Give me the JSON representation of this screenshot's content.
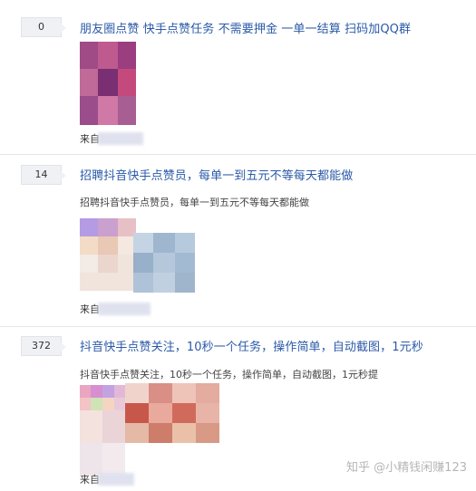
{
  "posts": [
    {
      "count": "0",
      "title": "朋友圈点赞 快手点赞任务 不需要押金 一单一结算 扫码加QQ群",
      "summary": "",
      "source_label": "来自"
    },
    {
      "count": "14",
      "title": "招聘抖音快手点赞员，每单一到五元不等每天都能做",
      "summary": "招聘抖音快手点赞员，每单一到五元不等每天都能做",
      "source_label": "来自"
    },
    {
      "count": "372",
      "title": "抖音快手点赞关注，10秒一个任务，操作简单，自动截图，1元秒",
      "summary": "抖音快手点赞关注，10秒一个任务，操作简单，自动截图，1元秒提",
      "source_label": "来自"
    }
  ],
  "watermark": "知乎 @小精钱闲赚123",
  "colors": {
    "title": "#2b5aa8",
    "badge_bg": "#f0f1f4",
    "separator": "#e6e6e6"
  }
}
